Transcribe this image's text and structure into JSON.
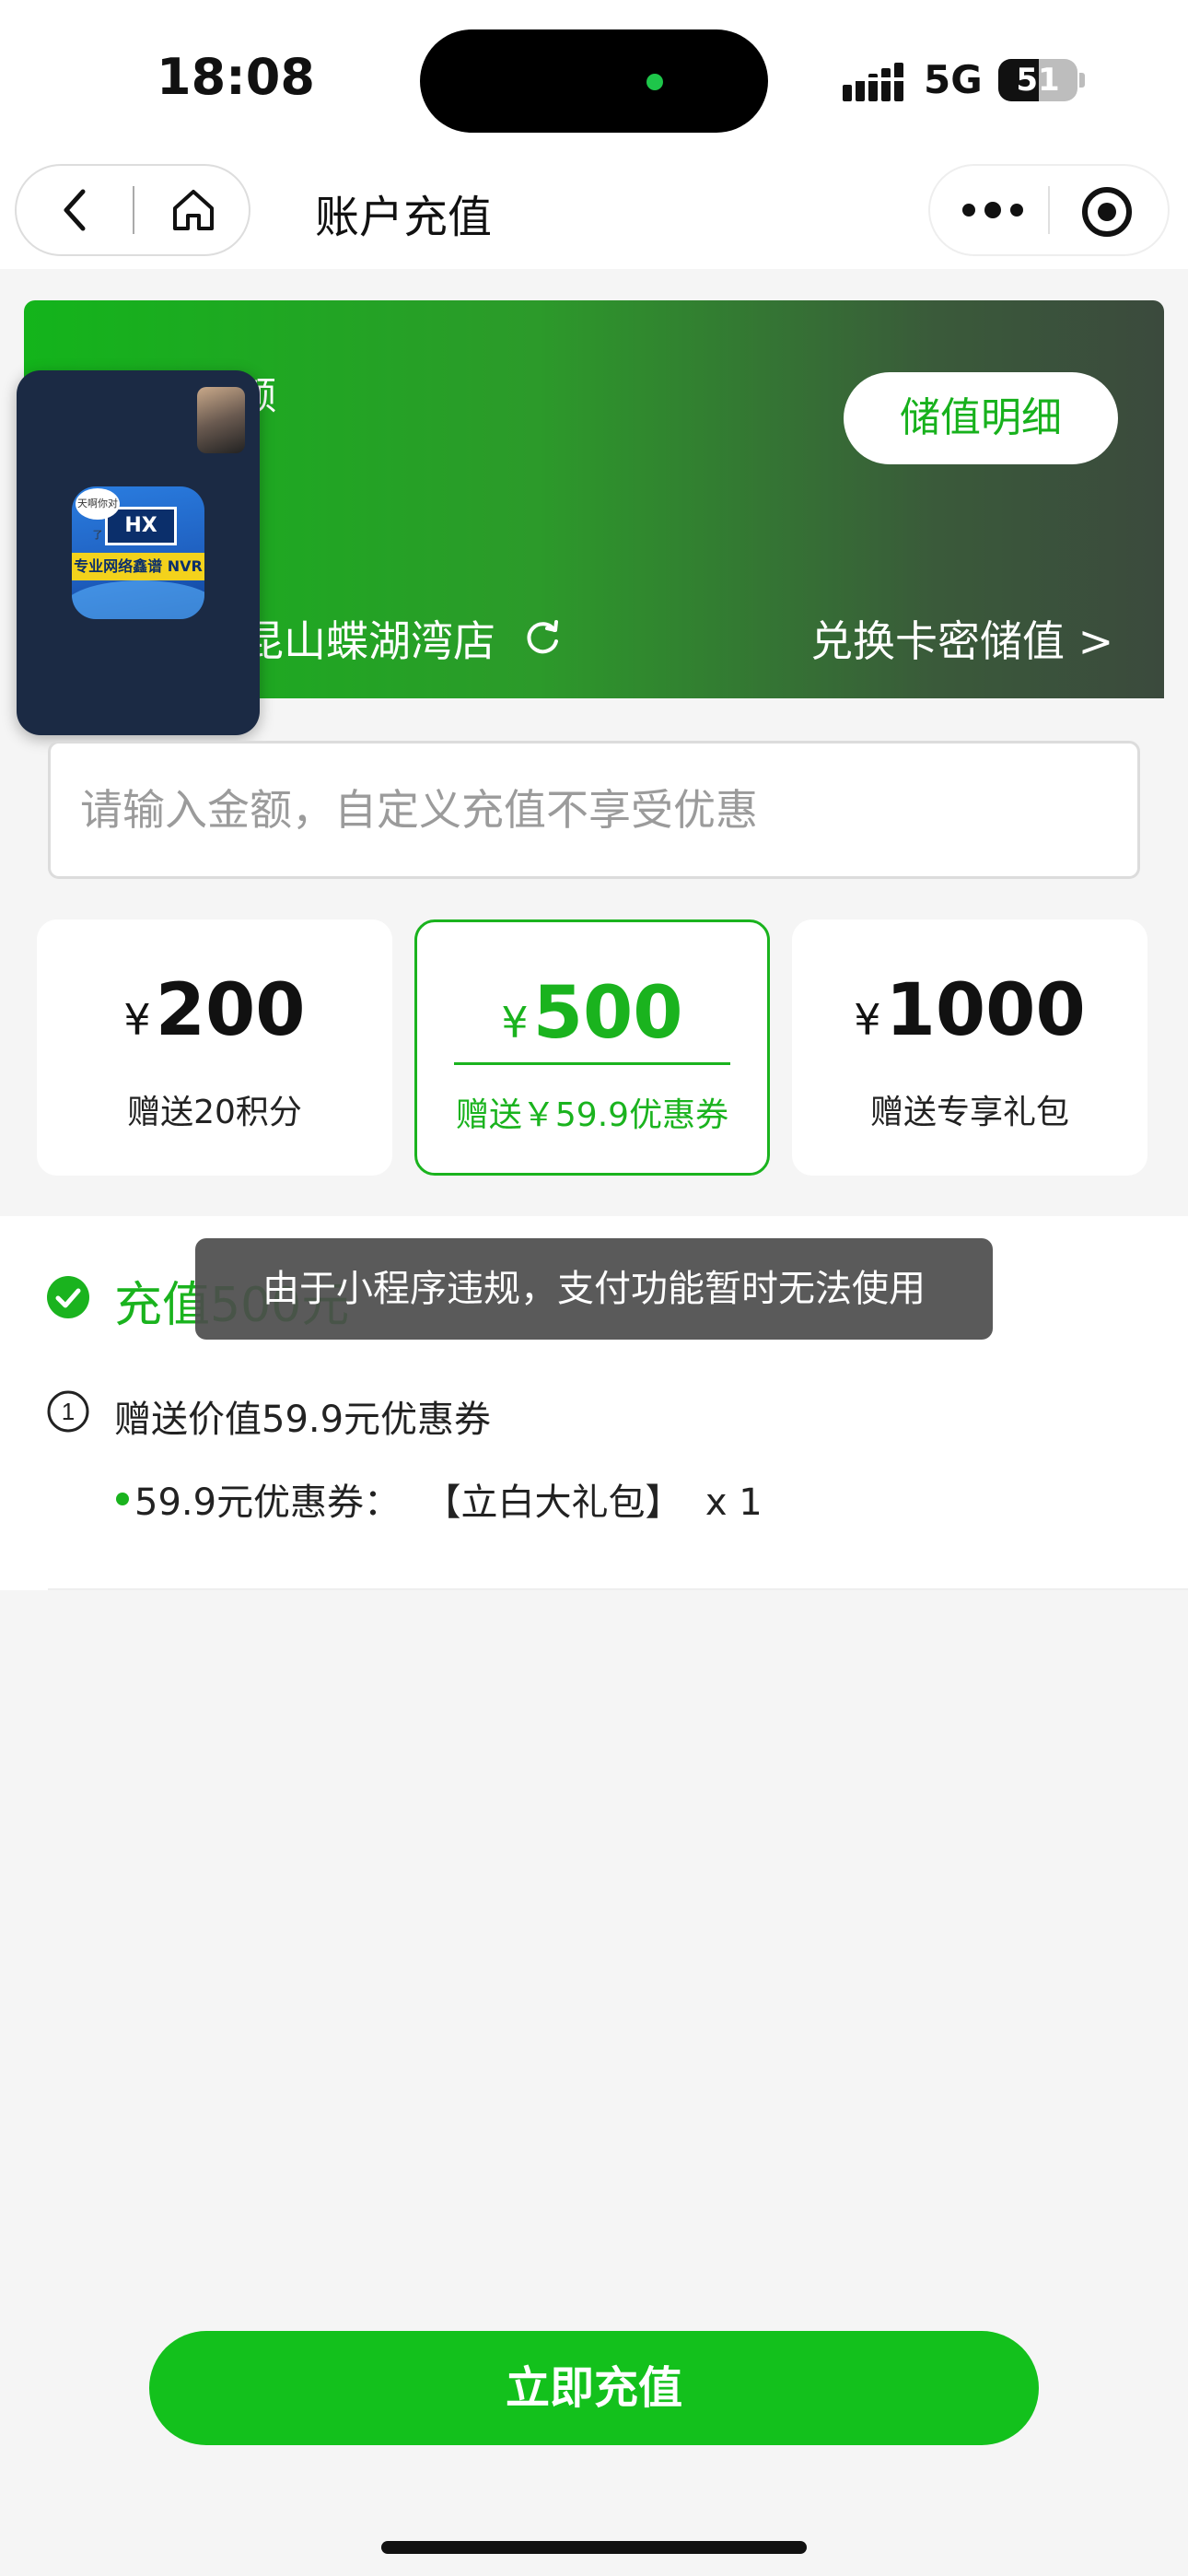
{
  "status_bar": {
    "time": "18:08",
    "network": "5G",
    "battery": "51"
  },
  "nav": {
    "title": "账户充值",
    "back_icon": "chevron-left-icon",
    "home_icon": "home-icon",
    "more_icon": "more-dots-icon",
    "target_icon": "record-target-icon"
  },
  "banner": {
    "balance_label_partial": "额",
    "detail_button": "储值明细",
    "store_name": "昆山蝶湖湾店",
    "redeem_link": "兑换卡密储值 >",
    "gradient_start": "#13b41b",
    "gradient_end": "#3b4a3d"
  },
  "amount_input": {
    "placeholder": "请输入金额，自定义充值不享受优惠",
    "value": ""
  },
  "price_options": [
    {
      "symbol": "¥",
      "amount": "200",
      "bonus": "赠送20积分",
      "selected": false
    },
    {
      "symbol": "¥",
      "amount": "500",
      "bonus": "赠送￥59.9优惠券",
      "selected": true
    },
    {
      "symbol": "¥",
      "amount": "1000",
      "bonus": "赠送专享礼包",
      "selected": false
    }
  ],
  "detail": {
    "selected_title": "充值500元",
    "gift_number": "①",
    "gift_title": "赠送价值59.9元优惠券",
    "gift_item": "59.9元优惠券：  【立白大礼包】  x 1"
  },
  "toast": {
    "message": "由于小程序违规，支付功能暂时无法使用"
  },
  "floating_window": {
    "app_icon": "nvr-app-icon",
    "app_logo_text": "HX",
    "app_band_text": "专业网络鑫谱 NVR",
    "bubble_text": "天啊你对了"
  },
  "actions": {
    "pay_button": "立即充值"
  },
  "colors": {
    "accent_green": "#1ab31e",
    "button_green": "#13c11c",
    "toast_bg": "#4c4c4c"
  }
}
